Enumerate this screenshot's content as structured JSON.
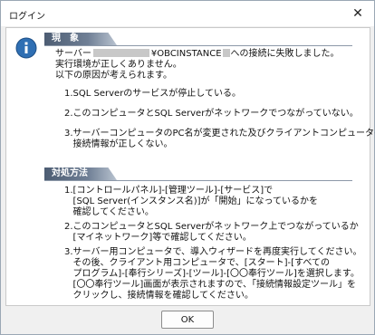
{
  "window": {
    "title": "ログイン",
    "close_glyph": "✕"
  },
  "phenomenon": {
    "header": "現　象",
    "line1_prefix": "サーバー",
    "line1_server": "¥OBCINSTANCE",
    "line1_suffix": "への接続に失敗しました。",
    "line2": "実行環境が正しくありません。",
    "line3": "以下の原因が考えられます。",
    "causes": [
      "1.SQL Serverのサービスが停止している。",
      "2.このコンピュータとSQL Serverがネットワークでつながっていない。",
      "3.サーバーコンピュータのPC名が変更された及びクライアントコンピュータの\n   接続情報が正しくない。"
    ]
  },
  "remedy": {
    "header": "対処方法",
    "steps": [
      "1.[コントロールパネル]-[管理ツール]-[サービス]で\n   [SQL Server(インスタンス名)]が「開始」になっているかを\n   確認してください。",
      "2.このコンピュータとSQL Serverがネットワーク上でつながっているか\n   [マイネットワーク]等で確認してください。",
      "3.サーバー用コンピュータで、導入ウィザードを再度実行してください。\n   その後、クライアント用コンピュータで、[スタート]-[すべての\n   プログラム]-[奉行シリーズ]-[ツール]-[〇〇奉行ツール]を選択します。\n   [〇〇奉行ツール]画面が表示されますので、「接続情報設定ツール」を\n   クリックし、接続情報を確認してください。"
    ]
  },
  "buttons": {
    "ok": "OK"
  },
  "icons": {
    "info": "info-icon",
    "close": "close-icon"
  },
  "colors": {
    "info_blue": "#2f6fb3",
    "header_dark": "#4d5d73"
  }
}
